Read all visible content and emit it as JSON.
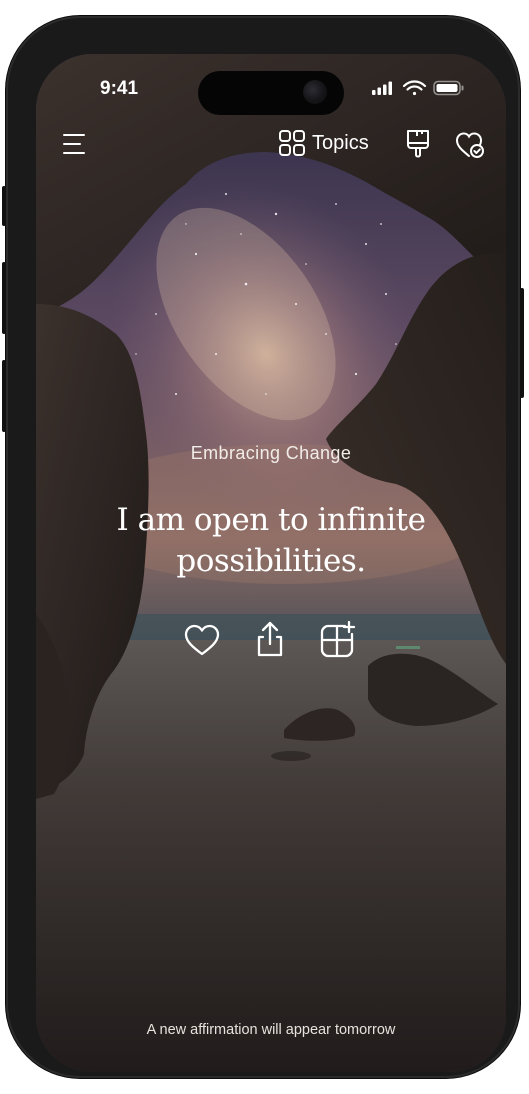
{
  "status_bar": {
    "time": "9:41",
    "icons": [
      "signal-icon",
      "wifi-icon",
      "battery-icon"
    ]
  },
  "toolbar": {
    "menu_icon": "hamburger-menu-icon",
    "topics_icon": "grid-icon",
    "topics_label": "Topics",
    "theme_icon": "paint-brush-icon",
    "favorites_icon": "heart-check-icon"
  },
  "content": {
    "topic": "Embracing Change",
    "affirmation": "I am open to infinite possibilities."
  },
  "actions": [
    {
      "name": "like",
      "icon": "heart-icon"
    },
    {
      "name": "share",
      "icon": "share-icon"
    },
    {
      "name": "add-to-collection",
      "icon": "add-widget-icon"
    }
  ],
  "footer": {
    "note": "A new affirmation will appear tomorrow"
  },
  "colors": {
    "text": "#ffffff",
    "phone_frame": "#1a1a1a",
    "water": "#4a403b",
    "sky": "#6c5a68"
  }
}
